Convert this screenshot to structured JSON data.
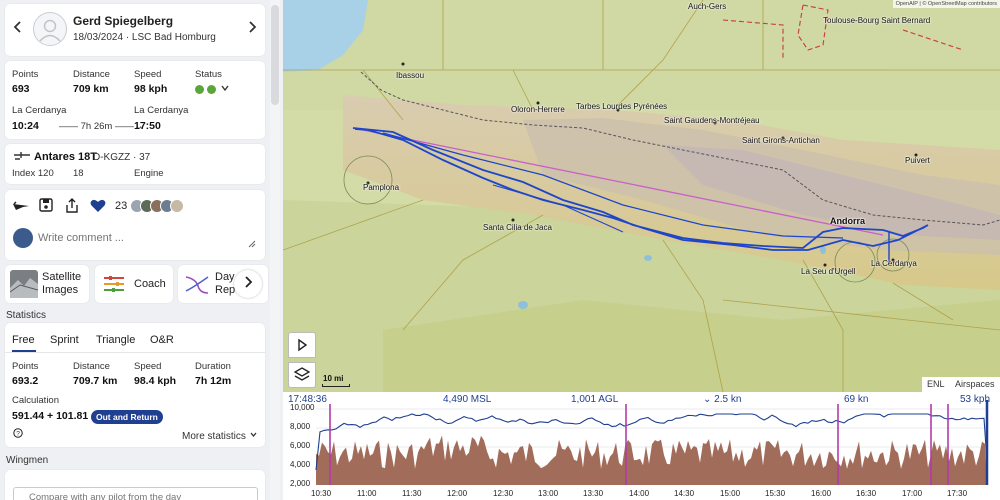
{
  "pilot": {
    "name": "Gerd Spiegelberg",
    "subtitle": "18/03/2024 · LSC Bad Homburg",
    "prev_icon": "chevron-left-icon",
    "next_icon": "chevron-right-icon"
  },
  "summary": {
    "points_label": "Points",
    "points_value": "693",
    "distance_label": "Distance",
    "distance_value": "709 km",
    "speed_label": "Speed",
    "speed_value": "98 kph",
    "status_label": "Status",
    "status_color": "#5ba63a",
    "takeoff_place": "La Cerdanya",
    "takeoff_time": "10:24",
    "duration": "—— 7h 26m ——→",
    "landing_place": "La Cerdanya",
    "landing_time": "17:50"
  },
  "glider": {
    "type": "Antares 18T",
    "registration": "D-KGZZ",
    "competition_id": "· 37",
    "index_text": "Index 120",
    "seats": "18",
    "engine_label": "Engine"
  },
  "social": {
    "like_count": "23",
    "like_color": "#1f3f91",
    "comment_placeholder": "Write comment ..."
  },
  "tools": {
    "satellite_line1": "Satellite",
    "satellite_line2": "Images",
    "coach_label": "Coach",
    "day_line1": "Day",
    "day_line2": "Rep"
  },
  "statistics": {
    "title": "Statistics",
    "tabs": [
      "Free",
      "Sprint",
      "Triangle",
      "O&R"
    ],
    "points_label": "Points",
    "points_value": "693.2",
    "distance_label": "Distance",
    "distance_value": "709.7 km",
    "speed_label": "Speed",
    "speed_value": "98.4 kph",
    "duration_label": "Duration",
    "duration_value": "7h 12m",
    "calculation_label": "Calculation",
    "calculation_value": "591.44 + 101.81",
    "badge": "Out and Return",
    "more_label": "More statistics"
  },
  "wingmen": {
    "title": "Wingmen",
    "compare_placeholder": "Compare with any pilot from the day"
  },
  "map": {
    "attribution": "OpenAIP | © OpenStreetMap contributors",
    "labels": [
      "Auch-Gers",
      "Toulouse-Bourg Saint Bernard",
      "Ibassou",
      "Oloron-Herrere",
      "Tarbes Lourdes Pyrénées",
      "Saint Gaudens-Montréjeau",
      "Saint Girons-Antichan",
      "Puivert",
      "Pamplona",
      "Santa Cilia de Jaca",
      "Andorra",
      "La Seu d'Urgell",
      "La Cerdanya"
    ],
    "scale_label": "10 mi",
    "layer_tabs": [
      "ENL",
      "Airspaces"
    ]
  },
  "barogram": {
    "readouts": [
      "17:48:36",
      "4,490 MSL",
      "1,001 AGL",
      "⌄ 2.5 kn",
      "69 kn",
      "53 kph"
    ],
    "y_ticks": [
      "10,000",
      "8,000",
      "6,000",
      "4,000",
      "2,000"
    ],
    "x_ticks": [
      "10:30",
      "11:00",
      "11:30",
      "12:00",
      "12:30",
      "13:00",
      "13:30",
      "14:00",
      "14:30",
      "15:00",
      "15:30",
      "16:00",
      "16:30",
      "17:00",
      "17:30"
    ],
    "altitude_color": "#1f3f91",
    "terrain_color": "#a26c5a"
  }
}
